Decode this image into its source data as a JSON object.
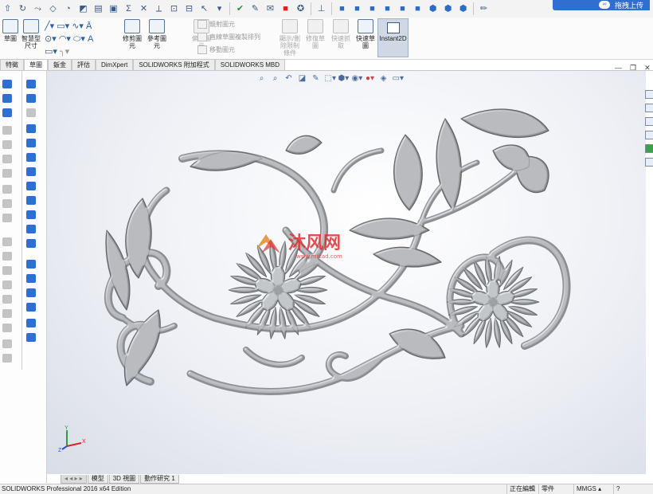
{
  "app": {
    "name": "SOLIDWORKS Professional 2016 x64 Edition"
  },
  "upload_button": {
    "label": "拖拽上传"
  },
  "ribbon": {
    "sketch": "草圖",
    "smart_dimension": "智慧型尺寸",
    "trim_entities": "修剪圖元",
    "convert_entities": "參考圖元",
    "offset_entities": "偏移圖元",
    "mirror_entities": "鏡射圖元",
    "linear_pattern": "直線草圖複製排列",
    "move_entities": "移動圖元",
    "display_delete_relations": "顯示/刪除限制條件",
    "repair_sketch": "修復草圖",
    "quick_snaps": "快速抓取",
    "rapid_sketch": "快速草圖",
    "instant2d": "Instant2D"
  },
  "tabs": [
    "特徵",
    "草圖",
    "鈑金",
    "評估",
    "DimXpert",
    "SOLIDWORKS 附加程式",
    "SOLIDWORKS MBD"
  ],
  "active_tab": "草圖",
  "bottom_tabs": [
    "模型",
    "3D 視圖",
    "動作研究 1"
  ],
  "status": {
    "left": "SOLIDWORKS Professional 2016 x64 Edition",
    "editing": "正在編輯",
    "part": "零件",
    "units": "MMGS"
  },
  "watermark": {
    "text": "沐风网",
    "url": "www.mfcad.com"
  },
  "triad": {
    "x": "X",
    "y": "Y",
    "z": "Z"
  },
  "colors": {
    "accent": "#2f6fd0",
    "model": "#8a8d92",
    "model_dark": "#5f6266"
  }
}
